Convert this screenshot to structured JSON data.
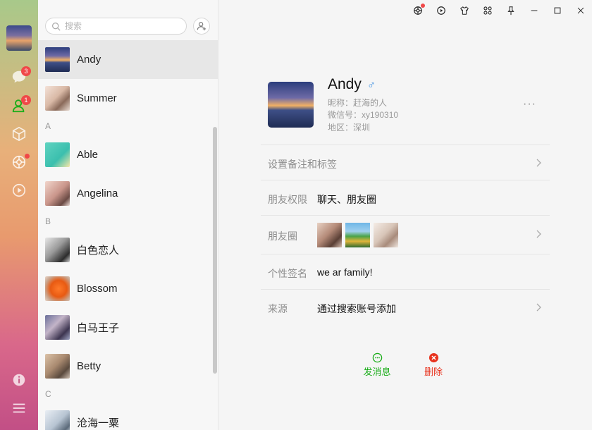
{
  "rail": {
    "chat_badge": "3",
    "contacts_badge": "1"
  },
  "search": {
    "placeholder": "搜索"
  },
  "contacts": {
    "pinned": [
      {
        "name": "Andy",
        "active": true
      },
      {
        "name": "Summer",
        "active": false
      }
    ],
    "sections": [
      {
        "letter": "A",
        "items": [
          {
            "name": "Able"
          },
          {
            "name": "Angelina"
          }
        ]
      },
      {
        "letter": "B",
        "items": [
          {
            "name": "白色恋人"
          },
          {
            "name": "Blossom"
          },
          {
            "name": "白马王子"
          },
          {
            "name": "Betty"
          }
        ]
      },
      {
        "letter": "C",
        "items": [
          {
            "name": "沧海一粟"
          }
        ]
      }
    ]
  },
  "profile": {
    "name": "Andy",
    "gender_symbol": "♂",
    "nickname": "昵称：赶海的人",
    "wechat_id": "微信号：xy190310",
    "region": "地区：深圳",
    "more": "···"
  },
  "details": {
    "remark_label": "设置备注和标签",
    "permission_label": "朋友权限",
    "permission_value": "聊天、朋友圈",
    "moments_label": "朋友圈",
    "signature_label": "个性签名",
    "signature_value": "we ar family!",
    "source_label": "来源",
    "source_value": "通过搜索账号添加"
  },
  "actions": {
    "message": "发消息",
    "delete": "删除"
  },
  "colors": {
    "accent_green": "#1aad19",
    "delete_red": "#e8341f",
    "badge_red": "#f04848",
    "gender_blue": "#3d8fe0"
  }
}
